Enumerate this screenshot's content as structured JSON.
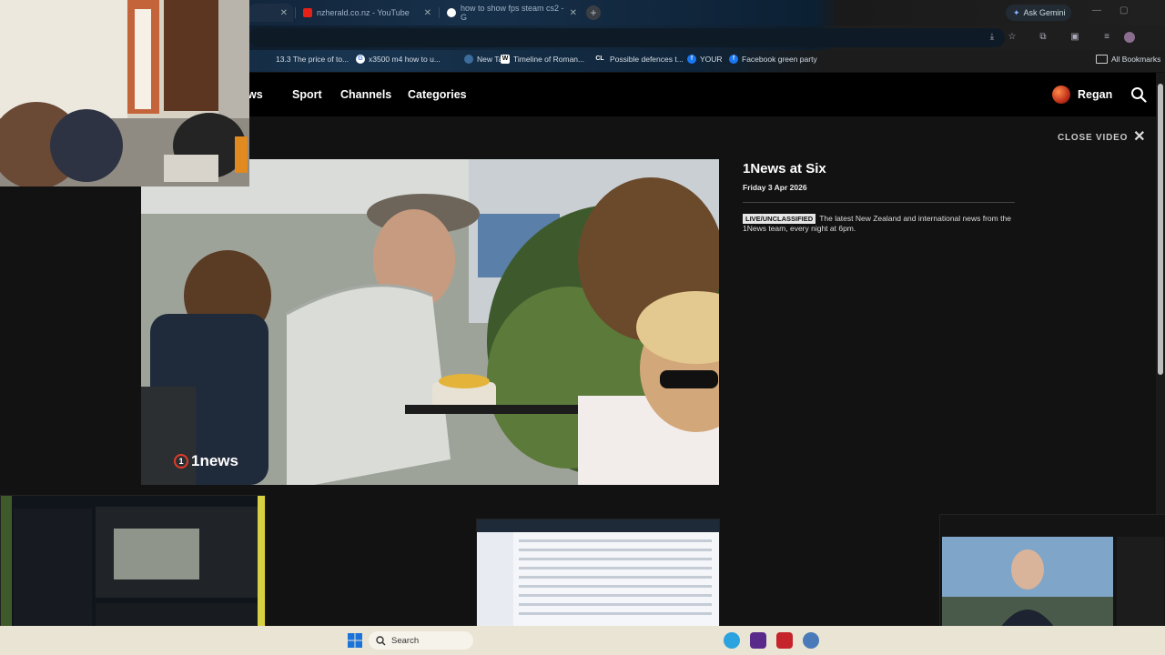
{
  "browser": {
    "tabs": [
      {
        "title": "",
        "icon": "blank-icon"
      },
      {
        "title": "nzherald.co.nz - YouTube",
        "icon": "youtube-icon"
      },
      {
        "title": "how to show fps steam cs2 - G",
        "icon": "google-icon"
      }
    ],
    "gemini_label": "Ask Gemini",
    "bookmarks": [
      {
        "label": "13.3 The price of to..."
      },
      {
        "label": "x3500 m4 how to u..."
      },
      {
        "label": "New Tab"
      },
      {
        "label": "Timeline of Roman..."
      },
      {
        "label": "Possible defences t..."
      },
      {
        "label": "YOUR"
      },
      {
        "label": "Facebook green party"
      }
    ],
    "all_bookmarks": "All Bookmarks"
  },
  "site": {
    "nav": [
      "News",
      "Sport",
      "Channels",
      "Categories"
    ],
    "user": "Regan",
    "close_video": "CLOSE VIDEO",
    "video": {
      "watermark": "1news",
      "title": "1News at Six",
      "date": "Friday 3 Apr 2026",
      "badge": "LIVE/UNCLASSIFIED",
      "description": "The latest New Zealand and international news from the 1News team, every night at 6pm."
    }
  },
  "taskbar": {
    "search_label": "Search"
  },
  "colors": {
    "page_bg": "#121212",
    "nav_bg": "#000000",
    "taskbar_bg": "#e9e4d4"
  }
}
